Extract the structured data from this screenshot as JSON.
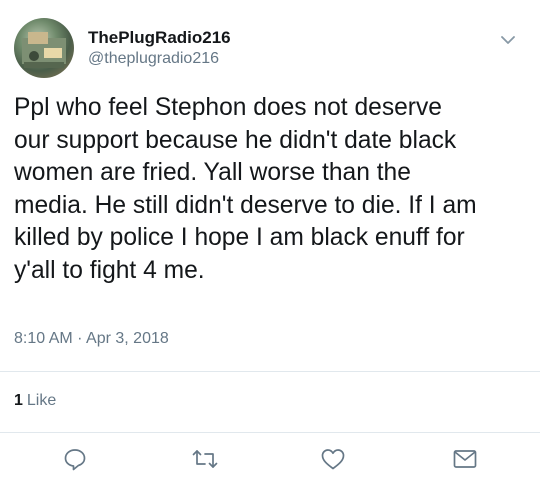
{
  "tweet": {
    "display_name": "ThePlugRadio216",
    "handle": "@theplugradio216",
    "text": "Ppl who feel Stephon does not deserve\nour support because he didn't date black\nwomen are fried. Yall worse than the\nmedia. He still didn't deserve to die. If I am\nkilled by police I hope I am black enuff for\ny'all to fight 4 me.",
    "timestamp": "8:10 AM · Apr 3, 2018",
    "like_count": "1",
    "like_label": "Like"
  },
  "icons": {
    "menu": "chevron-down-icon",
    "reply": "reply-icon",
    "retweet": "retweet-icon",
    "like": "heart-icon",
    "share": "mail-icon"
  },
  "colors": {
    "text": "#14171a",
    "secondary": "#657786",
    "divider": "#e1e8ed"
  }
}
